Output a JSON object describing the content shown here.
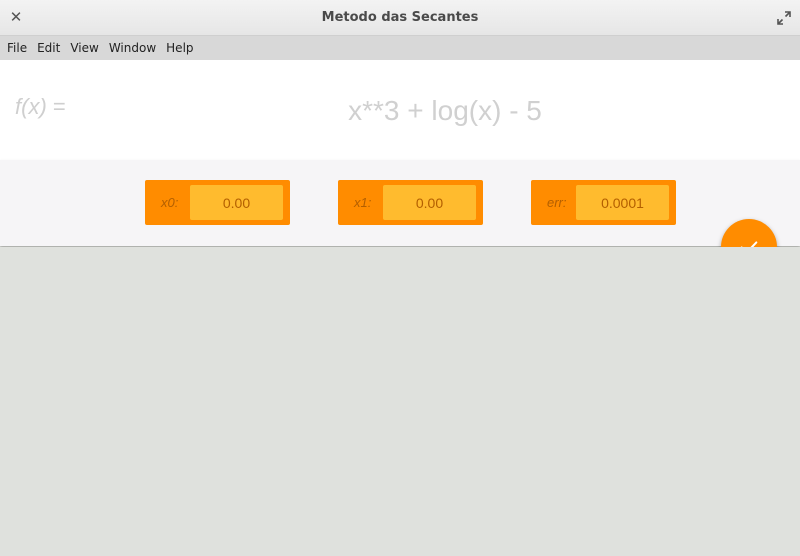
{
  "window": {
    "title": "Metodo das Secantes"
  },
  "menu": [
    {
      "label": "File"
    },
    {
      "label": "Edit"
    },
    {
      "label": "View"
    },
    {
      "label": "Window"
    },
    {
      "label": "Help"
    }
  ],
  "function": {
    "label_name": "f(x)",
    "label_eq": " =",
    "expression": "x**3 + log(x) - 5"
  },
  "params": {
    "x0": {
      "label": "x0:",
      "value": "0.00"
    },
    "x1": {
      "label": "x1:",
      "value": "0.00"
    },
    "err": {
      "label": "err:",
      "value": "0.0001"
    }
  },
  "colors": {
    "accent": "#ff8c00",
    "input_bg": "#ffbb2e",
    "label_text": "#b35f00"
  },
  "icons": {
    "close": "close-icon",
    "maximize": "maximize-icon",
    "submit": "check-icon"
  }
}
